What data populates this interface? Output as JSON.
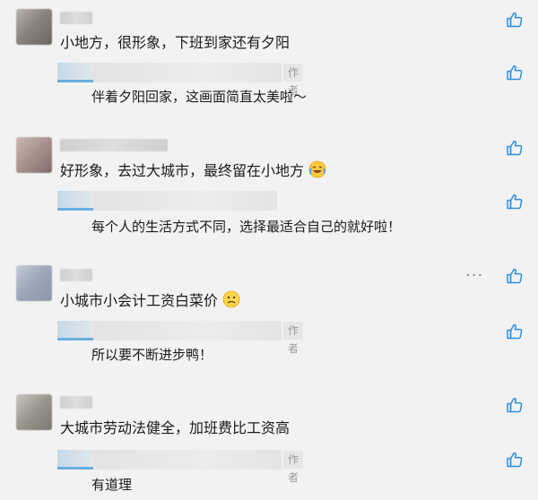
{
  "threads": [
    {
      "comment": "小地方，很形象，下班到家还有夕阳",
      "reply": {
        "tag": "作者",
        "text": "伴着夕阳回家，这画面简直太美啦～"
      }
    },
    {
      "comment": "好形象，去过大城市，最终留在小地方",
      "comment_emoji": "crying-laughing-emoji",
      "reply": {
        "tag": "作者",
        "text": "每个人的生活方式不同，选择最适合自己的就好啦！"
      }
    },
    {
      "comment": "小城市小会计工资白菜价",
      "comment_emoji": "frown-emoji",
      "more": "···",
      "reply": {
        "tag": "作者",
        "text": "所以要不断进步鸭！"
      }
    },
    {
      "comment": "大城市劳动法健全，加班费比工资高",
      "reply": {
        "tag": "作者",
        "text": "有道理"
      }
    }
  ],
  "icons": {
    "like": "thumbs-up-icon",
    "more": "more-icon"
  },
  "colors": {
    "background": "#f2f2f2",
    "text": "#1a1a1a",
    "like": "#2f8fdc",
    "author_tag_bg": "#e6e6e6"
  }
}
